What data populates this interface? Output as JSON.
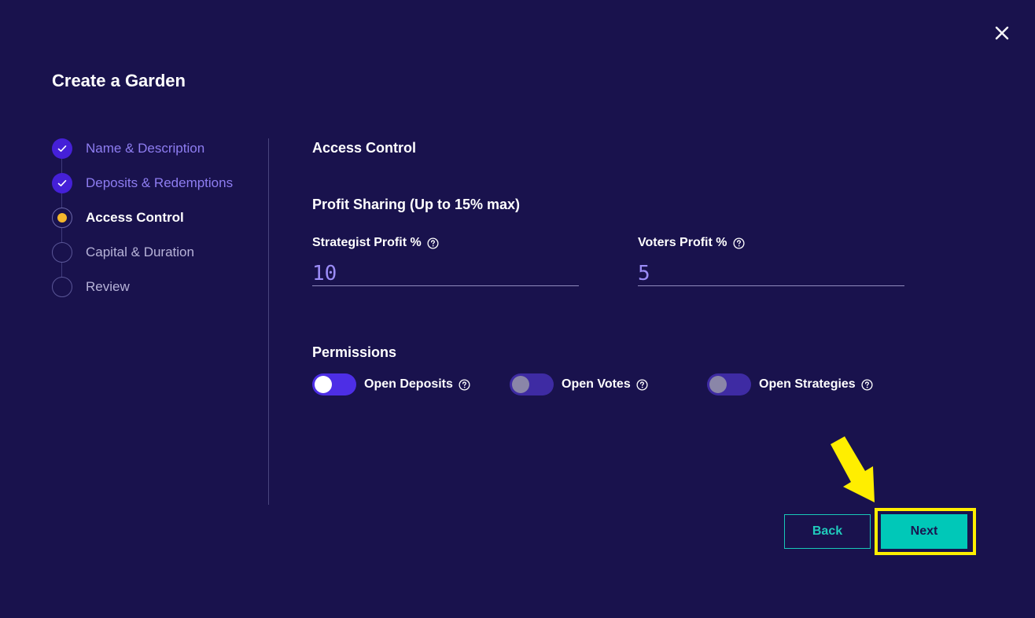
{
  "modal": {
    "title": "Create a Garden"
  },
  "steps": [
    {
      "label": "Name & Description",
      "state": "done"
    },
    {
      "label": "Deposits & Redemptions",
      "state": "done"
    },
    {
      "label": "Access Control",
      "state": "active"
    },
    {
      "label": "Capital & Duration",
      "state": "pending"
    },
    {
      "label": "Review",
      "state": "pending"
    }
  ],
  "content": {
    "section_title": "Access Control",
    "profit_sharing": {
      "heading": "Profit Sharing (Up to 15% max)",
      "strategist": {
        "label": "Strategist Profit %",
        "value": "10"
      },
      "voters": {
        "label": "Voters Profit %",
        "value": "5"
      }
    },
    "permissions": {
      "heading": "Permissions",
      "toggles": [
        {
          "label": "Open Deposits",
          "on": true
        },
        {
          "label": "Open Votes",
          "on": false
        },
        {
          "label": "Open Strategies",
          "on": false
        }
      ]
    }
  },
  "actions": {
    "back_label": "Back",
    "next_label": "Next"
  },
  "icons": {
    "close": "close-icon",
    "check": "check-icon",
    "help": "help-circle-icon",
    "annotation_arrow": "arrow-down-left-icon"
  },
  "colors": {
    "background": "#19124d",
    "accent_purple": "#4520d8",
    "active_step_dot": "#f5b72d",
    "teal": "#00c8b8",
    "highlight": "#ffee00"
  }
}
